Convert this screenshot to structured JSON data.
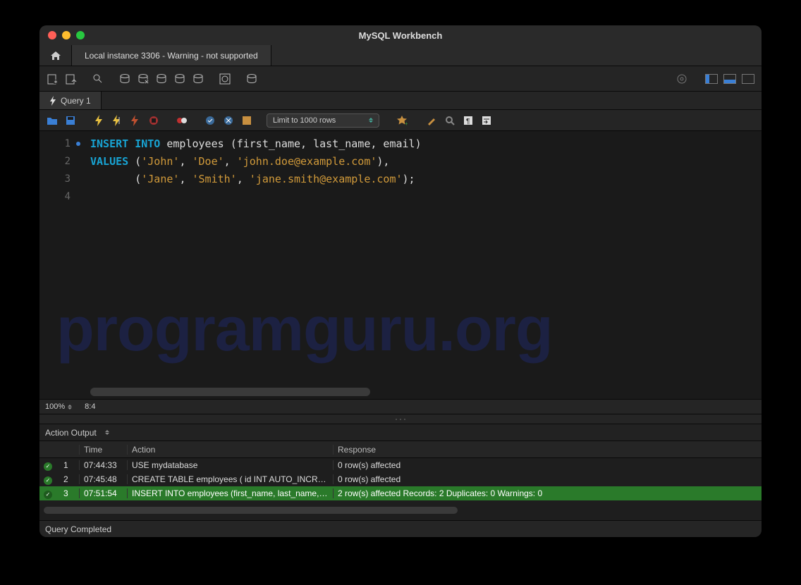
{
  "window": {
    "title": "MySQL Workbench"
  },
  "connection_tab": "Local instance 3306 - Warning - not supported",
  "query_tab": "Query 1",
  "limit_selector": "Limit to 1000 rows",
  "zoom": "100%",
  "cursor_pos": "8:4",
  "output_panel_label": "Action Output",
  "watermark": "programguru.org",
  "sql": {
    "line1": {
      "kw1": "INSERT",
      "kw2": "INTO",
      "tbl": "employees",
      "cols": "(first_name, last_name, email)"
    },
    "line2": {
      "kw": "VALUES",
      "v1": "'John'",
      "v2": "'Doe'",
      "v3": "'john.doe@example.com'",
      "tail": "),"
    },
    "line3": {
      "v1": "'Jane'",
      "v2": "'Smith'",
      "v3": "'jane.smith@example.com'",
      "tail": ");"
    }
  },
  "columns": {
    "time": "Time",
    "action": "Action",
    "response": "Response"
  },
  "rows": [
    {
      "n": "1",
      "time": "07:44:33",
      "action": "USE mydatabase",
      "response": "0 row(s) affected"
    },
    {
      "n": "2",
      "time": "07:45:48",
      "action": "CREATE TABLE employees (     id INT AUTO_INCREM…",
      "response": "0 row(s) affected"
    },
    {
      "n": "3",
      "time": "07:51:54",
      "action": "INSERT INTO employees (first_name, last_name, em…",
      "response": "2 row(s) affected Records: 2  Duplicates: 0  Warnings: 0"
    }
  ],
  "status": "Query Completed"
}
